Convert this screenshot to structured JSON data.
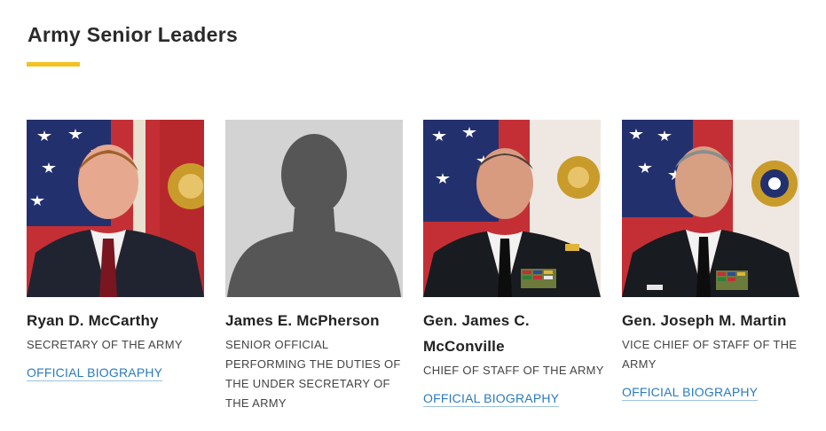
{
  "section": {
    "title": "Army Senior Leaders"
  },
  "colors": {
    "accent_rule": "#f2c220",
    "link": "#2a7bbd"
  },
  "leaders": [
    {
      "name": "Ryan D. McCarthy",
      "role": "SECRETARY OF THE ARMY",
      "link": "OFFICIAL BIOGRAPHY"
    },
    {
      "name": "James E. McPherson",
      "role": "SENIOR OFFICIAL PERFORMING THE DUTIES OF THE UNDER SECRETARY OF THE ARMY",
      "link": ""
    },
    {
      "name": "Gen. James C. McConville",
      "role": "CHIEF OF STAFF OF THE ARMY",
      "link": "OFFICIAL BIOGRAPHY"
    },
    {
      "name": "Gen. Joseph M. Martin",
      "role": "VICE CHIEF OF STAFF OF THE ARMY",
      "link": "OFFICIAL BIOGRAPHY"
    }
  ]
}
